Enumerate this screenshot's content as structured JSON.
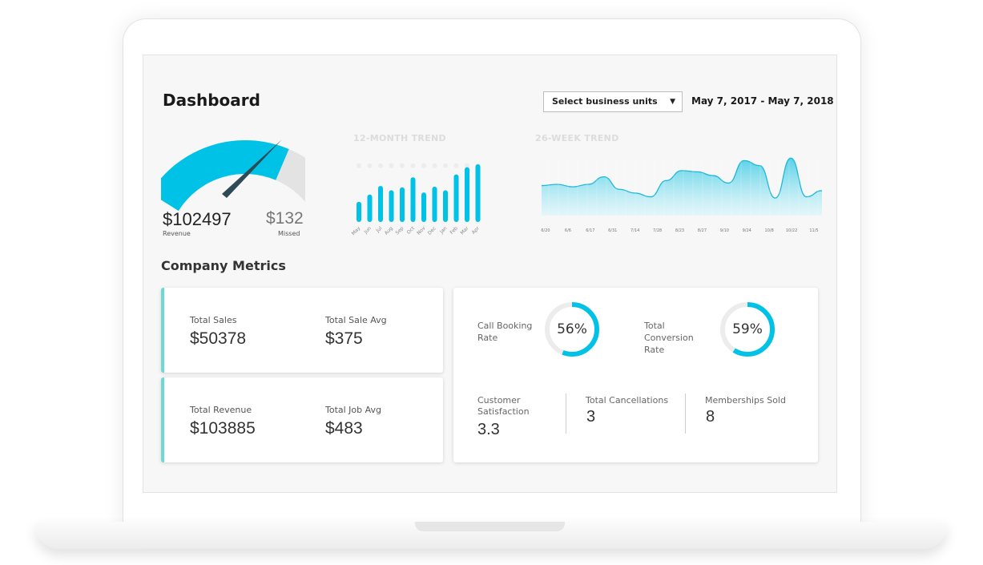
{
  "header": {
    "title": "Dashboard",
    "business_units_placeholder": "Select business units",
    "date_range": "May 7, 2017 - May 7, 2018"
  },
  "gauge": {
    "revenue_value": "$102497",
    "revenue_label": "Revenue",
    "missed_value": "$132",
    "missed_label": "Missed",
    "fill_color": "#00c2e6",
    "needle_color": "#2d4a56"
  },
  "trends": {
    "twelve_month_title": "12-MONTH TREND",
    "twenty_six_week_title": "26-WEEK TREND"
  },
  "chart_data": [
    {
      "type": "bar",
      "title": "12-MONTH TREND",
      "categories": [
        "May",
        "Jun",
        "Jul",
        "Aug",
        "Sep",
        "Oct",
        "Nov",
        "Dec",
        "Jan",
        "Feb",
        "Mar",
        "Apr"
      ],
      "values": [
        28,
        38,
        50,
        44,
        48,
        62,
        41,
        49,
        44,
        66,
        76,
        80
      ],
      "ylim": [
        0,
        100
      ],
      "grid": false
    },
    {
      "type": "area",
      "title": "26-WEEK TREND",
      "categories": [
        "6/20",
        "6/6",
        "6/17",
        "6/31",
        "7/14",
        "7/28",
        "8/23",
        "8/27",
        "9/10",
        "9/24",
        "10/8",
        "10/22",
        "11/5"
      ],
      "values": [
        48,
        50,
        46,
        50,
        62,
        42,
        36,
        30,
        56,
        72,
        70,
        64,
        52,
        88,
        80,
        28,
        92,
        30,
        40
      ],
      "ylim": [
        0,
        100
      ],
      "grid": false
    }
  ],
  "metrics": {
    "title": "Company Metrics",
    "total_sales_label": "Total Sales",
    "total_sales_value": "$50378",
    "total_sale_avg_label": "Total Sale Avg",
    "total_sale_avg_value": "$375",
    "total_revenue_label": "Total Revenue",
    "total_revenue_value": "$103885",
    "total_job_avg_label": "Total Job Avg",
    "total_job_avg_value": "$483",
    "call_booking_label": "Call Booking Rate",
    "call_booking_value": "56%",
    "call_booking_pct": 56,
    "conversion_label": "Total Conversion Rate",
    "conversion_value": "59%",
    "conversion_pct": 59,
    "satisfaction_label": "Customer Satisfaction",
    "satisfaction_value": "3.3",
    "cancellations_label": "Total Cancellations",
    "cancellations_value": "3",
    "memberships_label": "Memberships Sold",
    "memberships_value": "8"
  },
  "colors": {
    "accent": "#00c2e6",
    "accent_light": "#6fd8d4",
    "ring_track": "#ececec"
  }
}
